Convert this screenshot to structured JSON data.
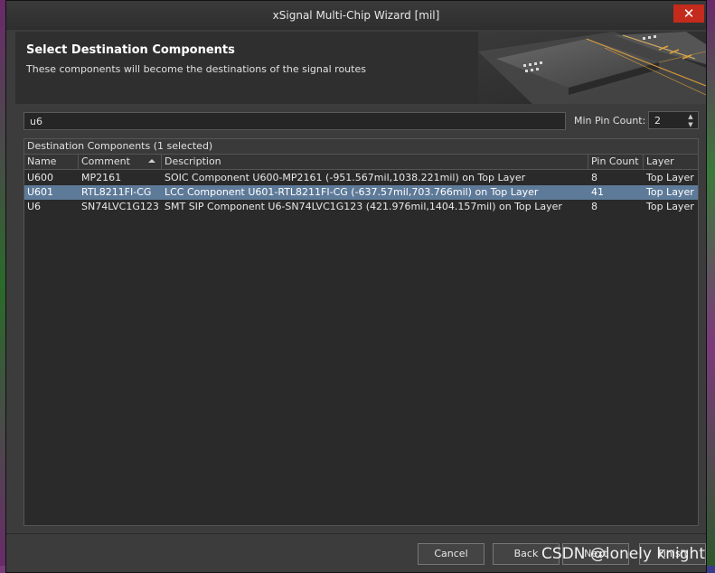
{
  "window": {
    "title": "xSignal Multi-Chip Wizard [mil]",
    "close_glyph": "✕"
  },
  "header": {
    "title": "Select Destination Components",
    "subtitle": "These components will become the destinations of the signal routes"
  },
  "filter": {
    "search_value": "u6",
    "min_pin_label": "Min Pin Count:",
    "min_pin_value": "2"
  },
  "table": {
    "caption": "Destination Components (1 selected)",
    "columns": {
      "name": "Name",
      "comment": "Comment",
      "description": "Description",
      "pin_count": "Pin Count",
      "layer": "Layer"
    },
    "sort_column": "comment",
    "rows": [
      {
        "name": "U600",
        "comment": "MP2161",
        "description": "SOIC Component U600-MP2161 (-951.567mil,1038.221mil) on Top Layer",
        "pin_count": "8",
        "layer": "Top Layer",
        "selected": false
      },
      {
        "name": "U601",
        "comment": "RTL8211FI-CG",
        "description": "LCC Component U601-RTL8211FI-CG (-637.57mil,703.766mil) on Top Layer",
        "pin_count": "41",
        "layer": "Top Layer",
        "selected": true
      },
      {
        "name": "U6",
        "comment": "SN74LVC1G123",
        "description": "SMT SIP Component U6-SN74LVC1G123 (421.976mil,1404.157mil) on Top Layer",
        "pin_count": "8",
        "layer": "Top Layer",
        "selected": false
      }
    ]
  },
  "buttons": {
    "cancel": "Cancel",
    "back": "Back",
    "next": "Next",
    "finish": "Finish"
  },
  "watermark": "CSDN @lonely knight",
  "colors": {
    "selection": "#5e7a99",
    "close": "#c42b1c",
    "accent_glow": "#e6a43a"
  }
}
